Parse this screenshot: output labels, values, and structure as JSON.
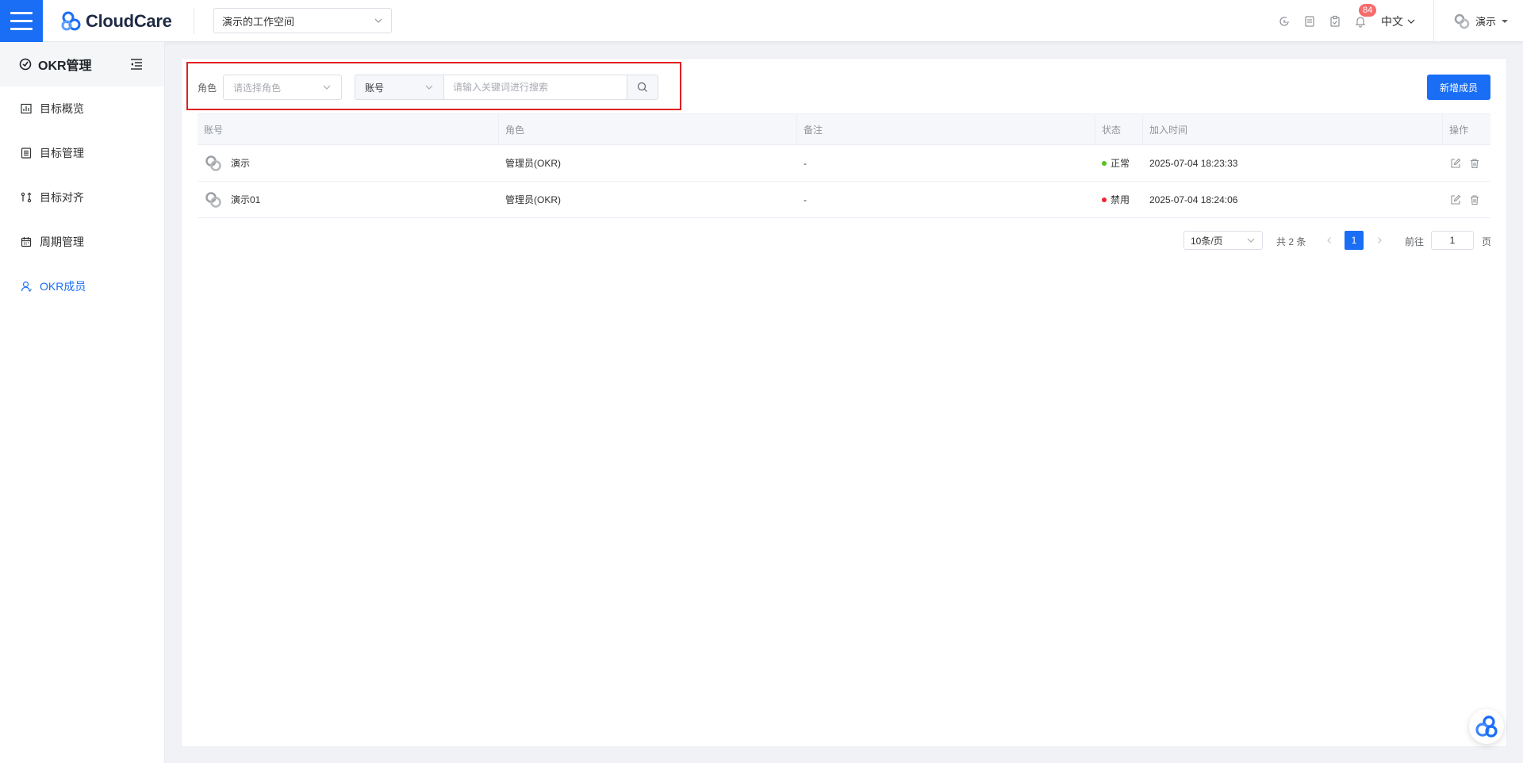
{
  "topbar": {
    "logo_text": "CloudCare",
    "workspace": "演示的工作空间",
    "notification_count": "84",
    "language": "中文",
    "user_name": "演示"
  },
  "sidebar": {
    "title": "OKR管理",
    "items": [
      {
        "label": "目标概览",
        "icon": "dashboard-icon"
      },
      {
        "label": "目标管理",
        "icon": "list-icon"
      },
      {
        "label": "目标对齐",
        "icon": "align-icon"
      },
      {
        "label": "周期管理",
        "icon": "calendar-icon"
      },
      {
        "label": "OKR成员",
        "icon": "user-icon",
        "active": true
      }
    ]
  },
  "filter": {
    "role_label": "角色",
    "role_placeholder": "请选择角色",
    "field_select": "账号",
    "search_placeholder": "请输入关键词进行搜索"
  },
  "add_button": "新增成员",
  "table": {
    "headers": [
      "账号",
      "角色",
      "备注",
      "状态",
      "加入时间",
      "操作"
    ],
    "rows": [
      {
        "account": "演示",
        "role": "管理员(OKR)",
        "remark": "-",
        "status": "正常",
        "status_color": "#52c41a",
        "joined": "2025-07-04 18:23:33"
      },
      {
        "account": "演示01",
        "role": "管理员(OKR)",
        "remark": "-",
        "status": "禁用",
        "status_color": "#f5222d",
        "joined": "2025-07-04 18:24:06"
      }
    ]
  },
  "pagination": {
    "page_size": "10条/页",
    "total": "共 2 条",
    "current_page": "1",
    "goto_label": "前往",
    "goto_value": "1",
    "goto_suffix": "页"
  },
  "colors": {
    "primary": "#1a6ef5",
    "highlight_border": "#e02020"
  }
}
